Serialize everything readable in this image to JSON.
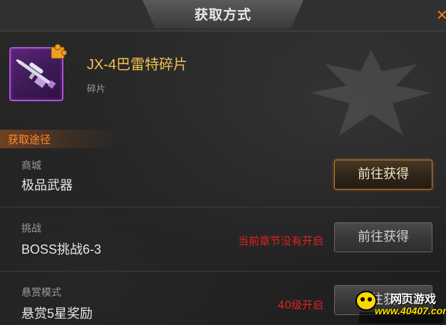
{
  "header": {
    "title": "获取方式",
    "close_glyph": "✕"
  },
  "item": {
    "name": "JX-4巴雷特碎片",
    "type": "碎片",
    "icon": "sniper-rifle-icon",
    "badge_icon": "puzzle-piece-icon"
  },
  "section": {
    "label": "获取途径"
  },
  "sources": [
    {
      "category": "商城",
      "name": "极品武器",
      "status": "",
      "button": "前往获得",
      "enabled": true
    },
    {
      "category": "挑战",
      "name": "BOSS挑战6-3",
      "status": "当前章节没有开启",
      "button": "前往获得",
      "enabled": false
    },
    {
      "category": "悬赏模式",
      "name": "悬赏5星奖励",
      "status": "40级开启",
      "button": "前往获得",
      "enabled": false
    }
  ],
  "watermark": {
    "line1": "网页游戏",
    "line2": "www.40407.com"
  },
  "colors": {
    "accent": "#ff8a2a",
    "item_name": "#f0c050",
    "status_red": "#e02020",
    "rarity_purple": "#b04fd6"
  }
}
